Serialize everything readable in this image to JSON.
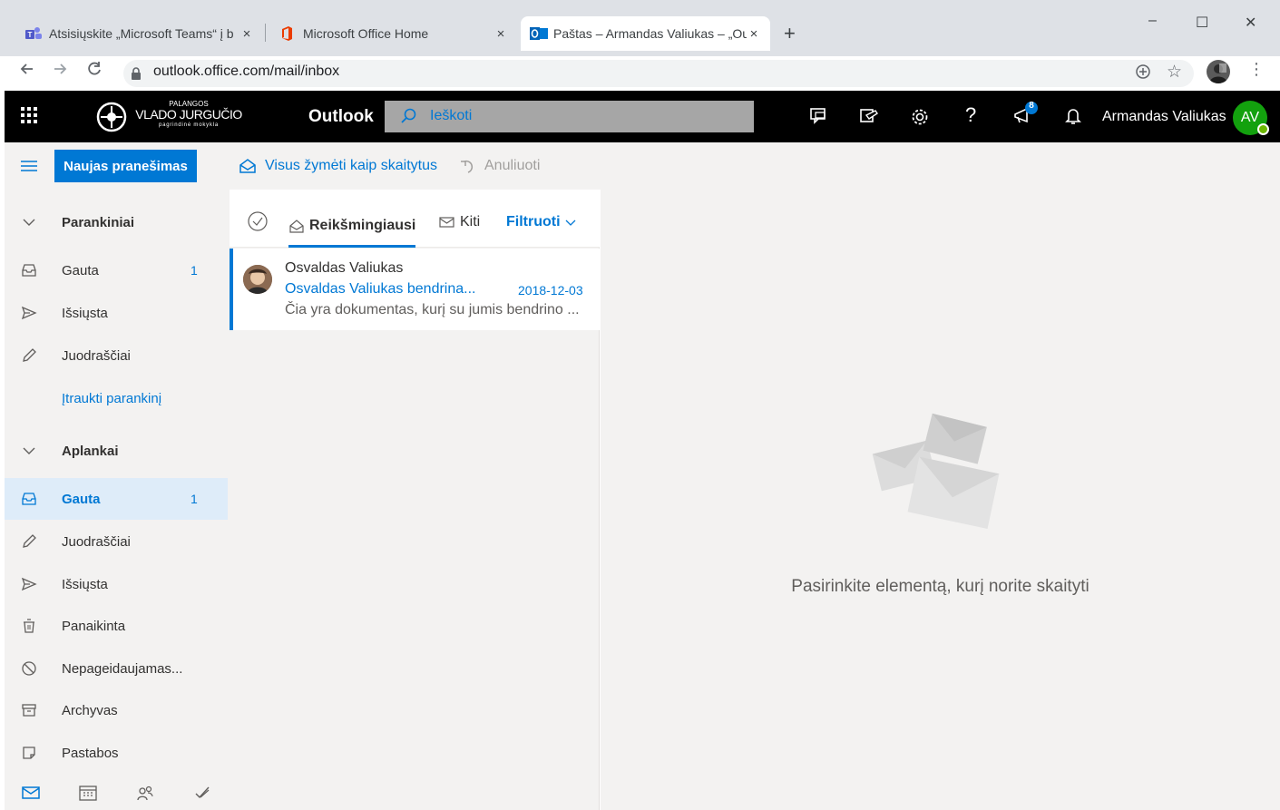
{
  "browser": {
    "tabs": [
      {
        "title": "Atsisiųskite „Microsoft Teams“ į b",
        "close": "×"
      },
      {
        "title": "Microsoft Office Home",
        "close": "×"
      },
      {
        "title": "Paštas – Armandas Valiukas – „Ou",
        "close": "×"
      }
    ],
    "new_tab": "+",
    "window_controls": {
      "minimize": "–",
      "maximize": "☐",
      "close": "✕"
    },
    "url": "outlook.office.com/mail/inbox"
  },
  "header": {
    "org_top": "PALANGOS",
    "org_name": "VLADO JURGUČIO",
    "org_sub": "pagrindinė mokykla",
    "app_name": "Outlook",
    "search_placeholder": "Ieškoti",
    "notification_count": "8",
    "user_name": "Armandas Valiukas",
    "user_initials": "AV"
  },
  "commands": {
    "new_message": "Naujas pranešimas",
    "mark_all_read": "Visus žymėti kaip skaitytus",
    "undo": "Anuliuoti"
  },
  "folders": {
    "favorites_header": "Parankiniai",
    "favorites": [
      {
        "label": "Gauta",
        "count": "1"
      },
      {
        "label": "Išsiųsta",
        "count": ""
      },
      {
        "label": "Juodraščiai",
        "count": ""
      }
    ],
    "add_favorite": "Įtraukti parankinį",
    "folders_header": "Aplankai",
    "folder_items": [
      {
        "label": "Gauta",
        "count": "1"
      },
      {
        "label": "Juodraščiai",
        "count": ""
      },
      {
        "label": "Išsiųsta",
        "count": ""
      },
      {
        "label": "Panaikinta",
        "count": ""
      },
      {
        "label": "Nepageidaujamas...",
        "count": ""
      },
      {
        "label": "Archyvas",
        "count": ""
      },
      {
        "label": "Pastabos",
        "count": ""
      }
    ]
  },
  "list": {
    "tab_focused": "Reikšmingiausi",
    "tab_other": "Kiti",
    "filter": "Filtruoti",
    "messages": [
      {
        "sender": "Osvaldas Valiukas",
        "subject": "Osvaldas Valiukas bendrina...",
        "date": "2018-12-03",
        "preview": "Čia yra dokumentas, kurį su jumis bendrino ..."
      }
    ]
  },
  "reading_pane": {
    "empty_text": "Pasirinkite elementą, kurį norite skaityti"
  },
  "colors": {
    "accent": "#0078d4",
    "header_bg": "#000000",
    "pane_bg": "#f3f2f1",
    "selected_bg": "#deecf9",
    "avatar_bg": "#13a10e"
  }
}
